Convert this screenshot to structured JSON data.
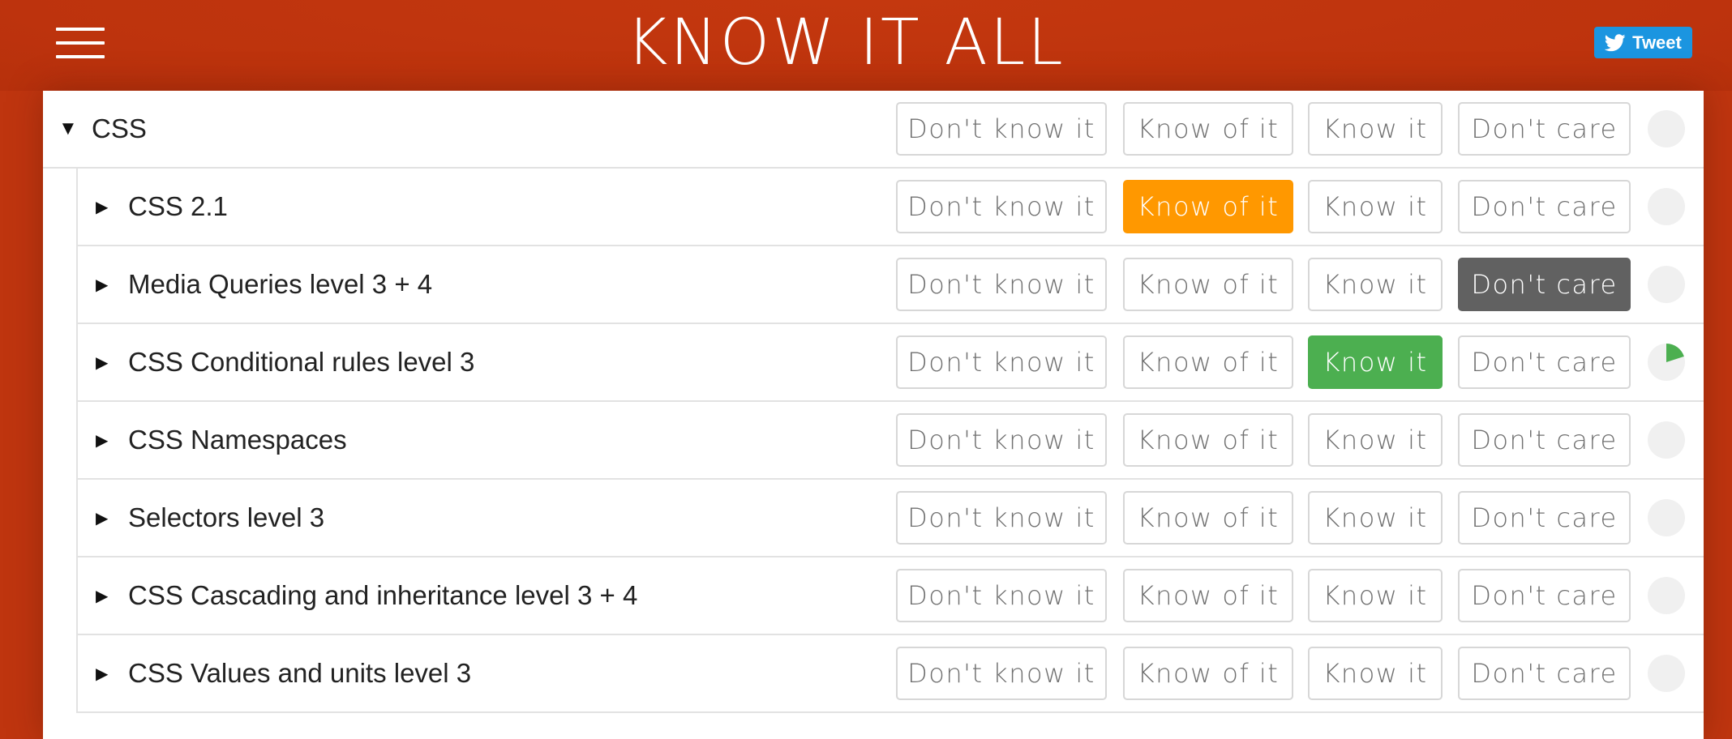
{
  "header": {
    "title": "KNOW IT ALL",
    "tweet_label": "Tweet"
  },
  "colors": {
    "header_bg": "#bf350f",
    "know_of_it": "#ff9800",
    "know_it": "#4caf50",
    "dont_care": "#616161",
    "tweet": "#1b95e0"
  },
  "options": {
    "dont_know": "Don't know it",
    "know_of": "Know of it",
    "know": "Know it",
    "dont_care": "Don't care"
  },
  "rows": [
    {
      "label": "CSS",
      "expanded": true,
      "selected": null,
      "progress": 0.0
    },
    {
      "label": "CSS 2.1",
      "expanded": false,
      "selected": "know_of",
      "progress": 0.0
    },
    {
      "label": "Media Queries level 3 + 4",
      "expanded": false,
      "selected": "dont_care",
      "progress": 0.0
    },
    {
      "label": "CSS Conditional rules level 3",
      "expanded": false,
      "selected": "know",
      "progress": 0.2
    },
    {
      "label": "CSS Namespaces",
      "expanded": false,
      "selected": null,
      "progress": 0.0
    },
    {
      "label": "Selectors level 3",
      "expanded": false,
      "selected": null,
      "progress": 0.0
    },
    {
      "label": "CSS Cascading and inheritance level 3 + 4",
      "expanded": false,
      "selected": null,
      "progress": 0.0
    },
    {
      "label": "CSS Values and units level 3",
      "expanded": false,
      "selected": null,
      "progress": 0.0
    }
  ]
}
